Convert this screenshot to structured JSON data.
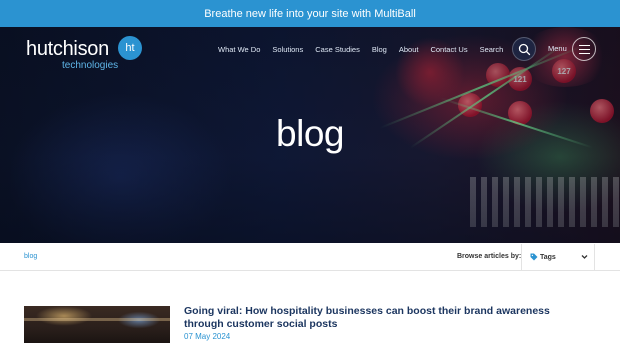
{
  "promo_banner": {
    "text": "Breathe new life into your site with MultiBall"
  },
  "logo": {
    "wordmark": "hutchison",
    "subtitle": "technologies",
    "badge": "ht"
  },
  "nav": {
    "items": [
      "What We Do",
      "Solutions",
      "Case Studies",
      "Blog",
      "About",
      "Contact Us"
    ],
    "search_label": "Search",
    "menu_label": "Menu"
  },
  "hero": {
    "title": "blog"
  },
  "breadcrumb": {
    "current": "blog"
  },
  "filter": {
    "browse_label": "Browse articles by:",
    "tags_label": "Tags"
  },
  "articles": [
    {
      "title": "Going viral: How hospitality businesses can boost their brand awareness through customer social posts",
      "date": "07 May 2024"
    }
  ],
  "colors": {
    "accent": "#2b93d1",
    "heading": "#1b355f"
  }
}
